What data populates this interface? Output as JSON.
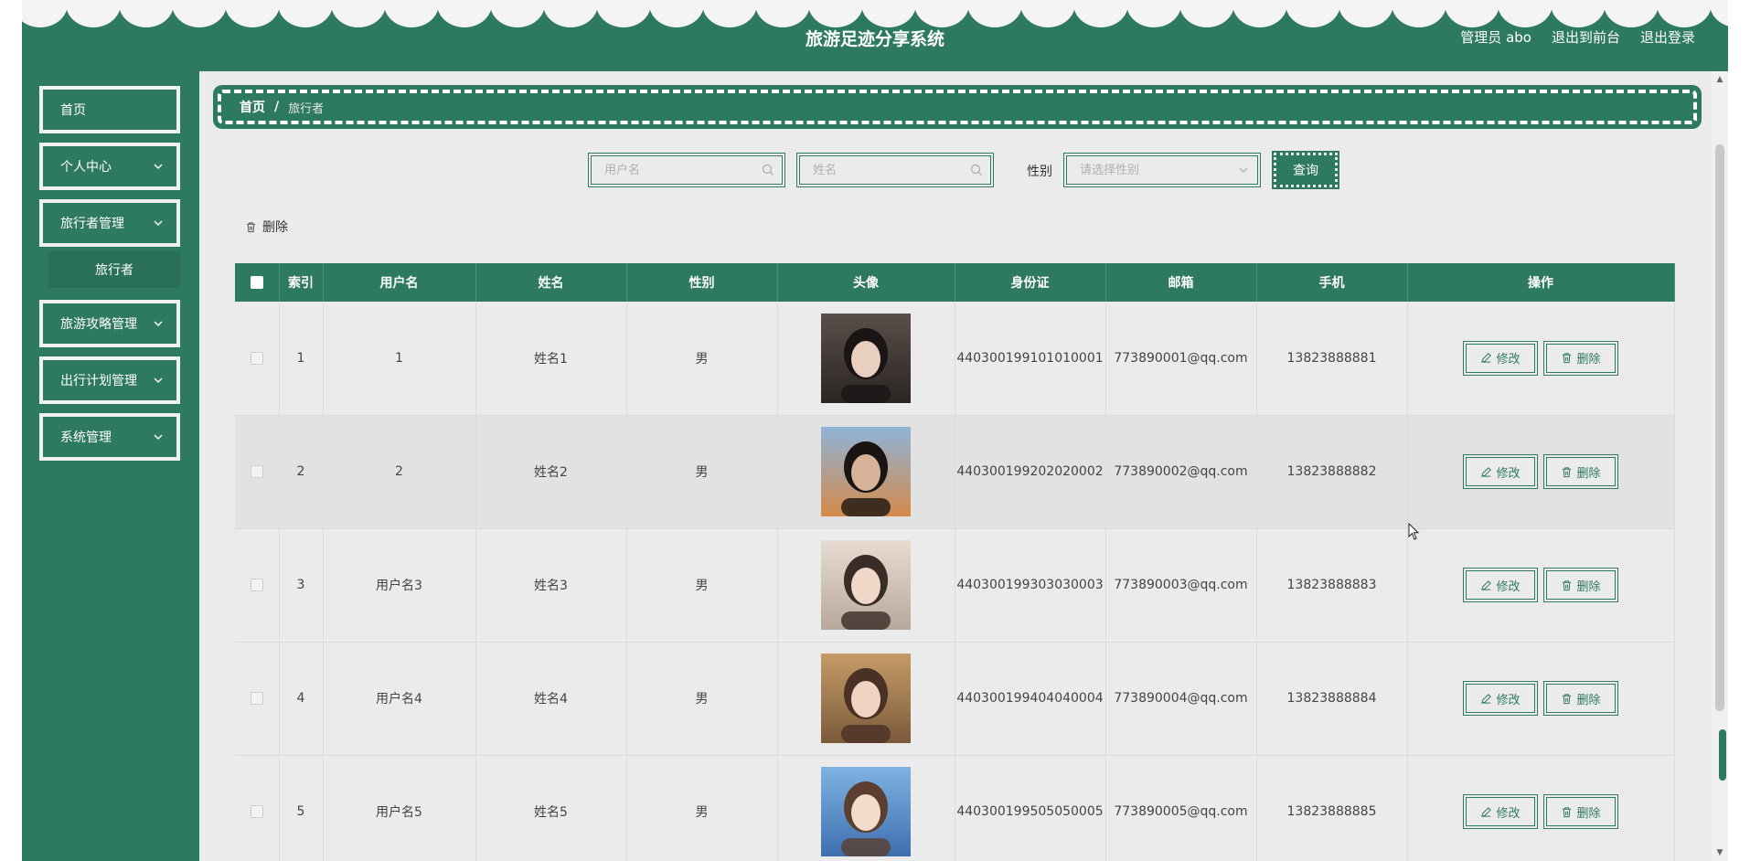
{
  "app": {
    "title": "旅游足迹分享系统",
    "admin_label": "管理员 abo",
    "back_to_front": "退出到前台",
    "logout": "退出登录"
  },
  "sidebar": {
    "items": [
      {
        "label": "首页",
        "has_chevron": false
      },
      {
        "label": "个人中心",
        "has_chevron": true
      },
      {
        "label": "旅行者管理",
        "has_chevron": true
      },
      {
        "label": "旅游攻略管理",
        "has_chevron": true
      },
      {
        "label": "出行计划管理",
        "has_chevron": true
      },
      {
        "label": "系统管理",
        "has_chevron": true
      }
    ],
    "subitem": "旅行者"
  },
  "breadcrumb": {
    "home": "首页",
    "separator": "/",
    "current": "旅行者"
  },
  "search": {
    "username_placeholder": "用户名",
    "name_placeholder": "姓名",
    "gender_label": "性别",
    "gender_placeholder": "请选择性别",
    "query_button": "查询"
  },
  "toolbar": {
    "delete_label": "删除"
  },
  "table": {
    "headers": [
      "",
      "索引",
      "用户名",
      "姓名",
      "性别",
      "头像",
      "身份证",
      "邮箱",
      "手机",
      "操作"
    ],
    "rows": [
      {
        "index": "1",
        "username": "1",
        "name": "姓名1",
        "gender": "男",
        "id_card": "440300199101010001",
        "email": "773890001@qq.com",
        "phone": "13823888881"
      },
      {
        "index": "2",
        "username": "2",
        "name": "姓名2",
        "gender": "男",
        "id_card": "440300199202020002",
        "email": "773890002@qq.com",
        "phone": "13823888882"
      },
      {
        "index": "3",
        "username": "用户名3",
        "name": "姓名3",
        "gender": "男",
        "id_card": "440300199303030003",
        "email": "773890003@qq.com",
        "phone": "13823888883"
      },
      {
        "index": "4",
        "username": "用户名4",
        "name": "姓名4",
        "gender": "男",
        "id_card": "440300199404040004",
        "email": "773890004@qq.com",
        "phone": "13823888884"
      },
      {
        "index": "5",
        "username": "用户名5",
        "name": "姓名5",
        "gender": "男",
        "id_card": "440300199505050005",
        "email": "773890005@qq.com",
        "phone": "13823888885"
      }
    ],
    "edit_label": "修改",
    "delete_label": "删除"
  },
  "colors": {
    "primary": "#2e7a5f",
    "content_bg": "#ebebeb"
  }
}
